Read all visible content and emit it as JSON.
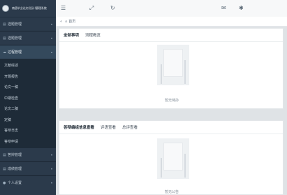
{
  "brand": {
    "title": "南昌毕业论文(设计)管理系统"
  },
  "sidebar": {
    "items": [
      {
        "label": "选题管理",
        "icon": "list-icon"
      },
      {
        "label": "选题管理",
        "icon": "list-icon"
      },
      {
        "label": "过程管理",
        "icon": "process-icon",
        "expanded": true
      }
    ],
    "sub_items": [
      "文献综述",
      "开题报告",
      "论文一稿",
      "中期检查",
      "论文二稿",
      "定稿",
      "答辩日志",
      "答辩申请"
    ],
    "bottom_items": [
      {
        "label": "答辩管理",
        "icon": "list-icon"
      },
      {
        "label": "成绩管理",
        "icon": "list-icon"
      },
      {
        "label": "个人设置",
        "icon": "user-icon"
      }
    ]
  },
  "topbar": {
    "icons": [
      "menu-icon",
      "fullscreen-icon",
      "refresh-icon",
      "mail-icon",
      "pin-icon"
    ]
  },
  "breadcrumb": {
    "home": "首页"
  },
  "panel1": {
    "tabs": [
      "全部事项",
      "流程概览"
    ],
    "empty_text": "暂无待办"
  },
  "panel2": {
    "tabs": [
      "答辩编组信息查看",
      "评语查看",
      "总评查看"
    ],
    "empty_text": "暂无公告"
  }
}
